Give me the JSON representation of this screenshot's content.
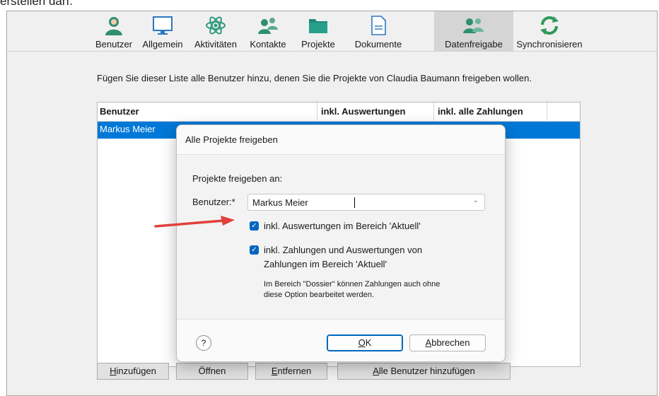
{
  "caption": "erstellen darf.",
  "toolbar": {
    "items": [
      {
        "label": "Benutzer",
        "icon": "user-icon"
      },
      {
        "label": "Allgemein",
        "icon": "monitor-icon"
      },
      {
        "label": "Aktivitäten",
        "icon": "atom-icon"
      },
      {
        "label": "Kontakte",
        "icon": "contacts-icon"
      },
      {
        "label": "Projekte",
        "icon": "folder-icon"
      },
      {
        "label": "Dokumente",
        "icon": "document-icon"
      },
      {
        "label": "Datenfreigabe",
        "icon": "share-users-icon",
        "active": true
      },
      {
        "label": "Synchronisieren",
        "icon": "sync-icon"
      }
    ]
  },
  "main": {
    "intro": "Fügen Sie dieser Liste alle Benutzer hinzu, denen Sie die Projekte von Claudia Baumann freigeben wollen.",
    "columns": [
      "Benutzer",
      "inkl. Auswertungen",
      "inkl. alle Zahlungen"
    ],
    "rows": [
      {
        "user": "Markus Meier"
      }
    ],
    "buttons": {
      "add": {
        "pre": "",
        "u": "H",
        "post": "inzufügen"
      },
      "open": "Öffnen",
      "remove": {
        "pre": "",
        "u": "E",
        "post": "ntfernen"
      },
      "add_all": {
        "pre": "",
        "u": "A",
        "post": "lle Benutzer hinzufügen"
      }
    }
  },
  "dialog": {
    "title": "Alle Projekte freigeben",
    "share_with_label": "Projekte freigeben an:",
    "user_label": "Benutzer:*",
    "user_value": "Markus Meier",
    "option1": "inkl. Auswertungen im Bereich 'Aktuell'",
    "option2_line1": "inkl. Zahlungen und Auswertungen von",
    "option2_line2": "Zahlungen im Bereich 'Aktuell'",
    "note_line1": "Im Bereich \"Dossier\" können Zahlungen auch ohne",
    "note_line2": "diese Option bearbeitet werden.",
    "help": "?",
    "ok": {
      "pre": "",
      "u": "O",
      "post": "K"
    },
    "cancel": {
      "pre": "",
      "u": "A",
      "post": "bbrechen"
    }
  },
  "colors": {
    "selection": "#0078d7",
    "checkbox": "#0067c0",
    "arrow": "#e0413a"
  }
}
